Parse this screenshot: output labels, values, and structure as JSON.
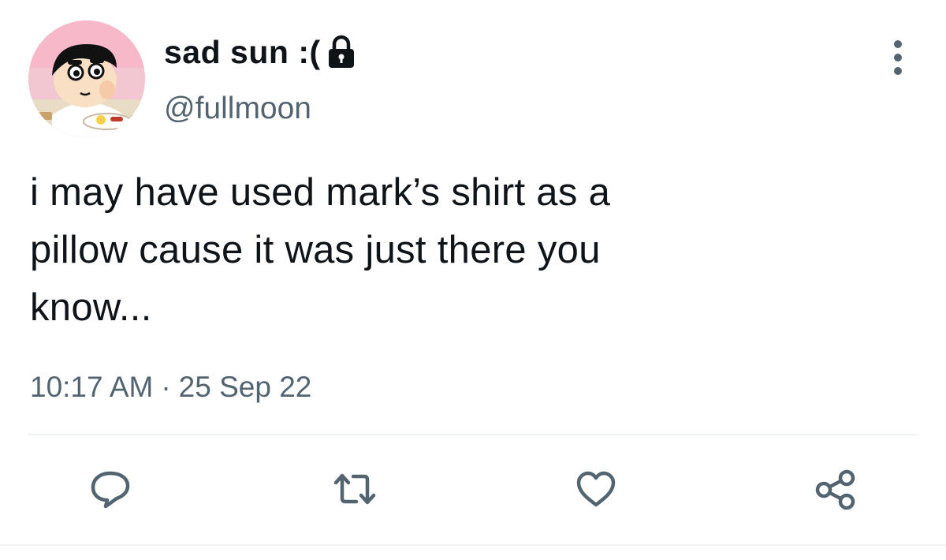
{
  "user": {
    "display_name": "sad sun :(",
    "handle": "@fullmoon",
    "avatar_icon": "avatar-cartoon-boy-eating",
    "locked_icon": "lock-icon"
  },
  "tweet": {
    "text_lines": [
      "i may have used mark’s shirt as a",
      "pillow cause it was just there you",
      "know..."
    ],
    "time": "10:17 AM",
    "separator": "·",
    "date": "25 Sep 22"
  },
  "actions": [
    {
      "icon": "reply-icon"
    },
    {
      "icon": "retweet-icon"
    },
    {
      "icon": "like-icon"
    },
    {
      "icon": "share-icon"
    }
  ],
  "colors": {
    "text_primary": "#0f1419",
    "text_secondary": "#536471",
    "icon": "#536471",
    "divider": "#eff3f4"
  }
}
